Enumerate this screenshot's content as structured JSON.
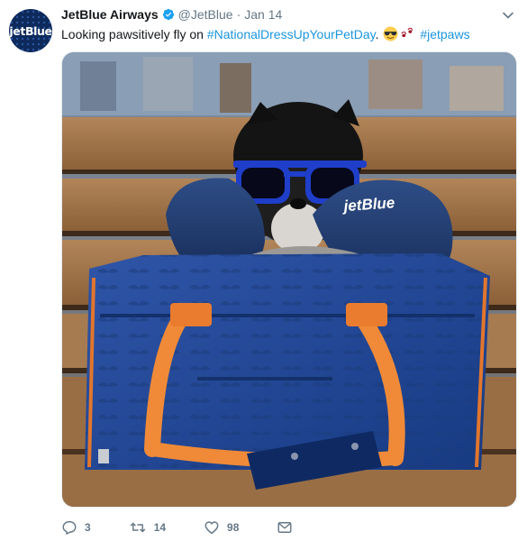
{
  "tweet": {
    "author_name": "JetBlue Airways",
    "handle": "@JetBlue",
    "separator": "·",
    "date": "Jan 14",
    "avatar_text": "jetBlue",
    "text_before": "Looking pawsitively fly on ",
    "hashtag_1": "#NationalDressUpYourPetDay",
    "text_between": ". ",
    "emojis": [
      "smiling-face-with-sunglasses",
      "paw-prints"
    ],
    "hashtag_2": "#jetpaws",
    "photo": {
      "pillow_text": "jetBlue"
    }
  },
  "actions": {
    "reply_count": "3",
    "retweet_count": "14",
    "like_count": "98"
  },
  "colors": {
    "link": "#1b95e0",
    "verified": "#1da1f2",
    "muted": "#657786",
    "brand_navy": "#0e2a5c"
  }
}
